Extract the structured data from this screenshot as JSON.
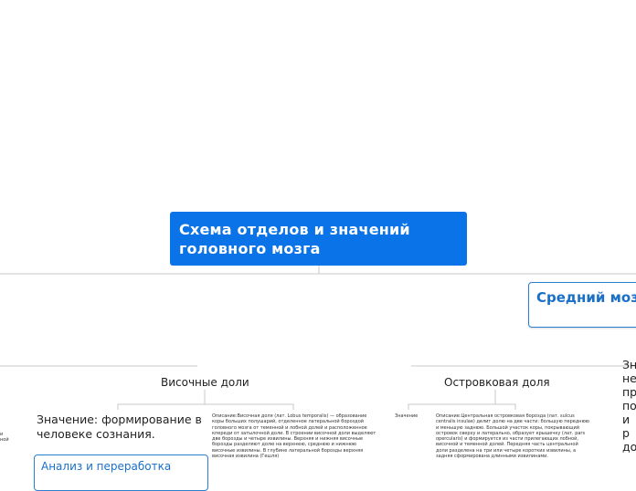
{
  "root": {
    "title": "Схема отделов и значений головного мозга"
  },
  "midbrain": {
    "title": "Средний мозг"
  },
  "temporal": {
    "title": "Височные доли",
    "value": "Значение: формирование в человеке сознания.",
    "description": "Описание:Височная доля (лат. Lobus temporalis) — образование коры больших полушарий, отделенное латеральной бороздой головного мозга от теменной и лобной долей и расположенное кпереди от затылочной доли. В строении височной доли выделяют две борозды и четыре извилины. Верхняя и нижняя височные борозды разделяют долю на верхнюю, среднюю и нижнюю височные извилины. В глубине латеральной борозды верхняя височная извилина (Гешля)",
    "child": "Анализ и переработка"
  },
  "insula": {
    "title": "Островковая доля",
    "value_label": "Значение",
    "description": "Описание:Центральная островковая борозда (лат. sulcus centralis insulae) делит долю на две части: большую переднюю и меньшую заднюю. Большой участок коры, покрывающий островок сверху и латерально, образует крышечку (лат. pars opercularis) и формируется из части прилегающих лобной, височной и теменной долей. Передняя часть центральной доли разделена на три или четыре коротких извилины, а задняя сформирована длинными извилинами."
  },
  "left_fragment": {
    "line1": "и",
    "line2": "ной"
  },
  "right_fragment": {
    "lines": [
      "Зн",
      "не",
      "пр",
      "по",
      "и р",
      "до"
    ]
  }
}
